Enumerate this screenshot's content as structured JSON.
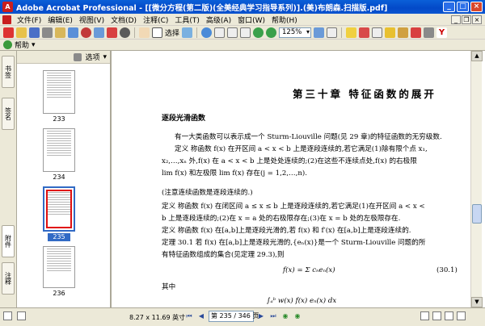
{
  "window": {
    "title": "Adobe Acrobat Professional - [[微分方程(第二版)(全美经典学习指导系列)].(美)布朗森.扫描版.pdf]",
    "app_icon": "acrobat-icon",
    "buttons": [
      "_",
      "□",
      "×"
    ]
  },
  "menubar": {
    "items": [
      "文件(F)",
      "编辑(E)",
      "视图(V)",
      "文档(D)",
      "注释(C)",
      "工具(T)",
      "高级(A)",
      "窗口(W)",
      "帮助(H)"
    ]
  },
  "toolbar": {
    "select_label": "选择",
    "zoom_value": "125%",
    "help_label": "帮助"
  },
  "thumbnails": {
    "options_label": "选项",
    "pages": [
      {
        "label": "233",
        "selected": false
      },
      {
        "label": "234",
        "selected": false
      },
      {
        "label": "235",
        "selected": true
      },
      {
        "label": "236",
        "selected": false
      }
    ]
  },
  "side_tabs": [
    "书签",
    "签名",
    "附件",
    "注释"
  ],
  "document": {
    "chapter_title": "第三十章   特征函数的展开",
    "section_title": "逐段光滑函数",
    "lines": [
      "有一大类函数可以表示成一个 Sturm-Liouville 问题(见 29 章)的特征函数的无穷级数.",
      "定义   称函数 f(x) 在开区间 a < x < b 上是逐段连续的,若它满足(1)除有限个点 x₁,",
      "x₂,…,xₙ 外,f(x) 在 a < x < b 上是处处连续的;(2)在这些不连续点处,f(x) 的右极限",
      "lim f(x) 和左极限 lim f(x) 存在(j = 1,2,…,n).",
      "(注意连续函数是逐段连续的.)",
      "定义   称函数 f(x) 在闭区间 a ≤ x ≤ b 上是逐段连续的,若它满足(1)在开区间 a < x <",
      "b 上是逐段连续的;(2)在 x = a 处的右极限存在;(3)在 x = b 处的左极限存在.",
      "定义   称函数 f(x) 在[a,b]上是逐段光滑的,若 f(x) 和 f′(x) 在[a,b]上是逐段连续的.",
      "定理 30.1   若 f(x) 在[a,b]上是逐段光滑的,{eₙ(x)}是一个 Sturm-Liouville 问题的所",
      "有特征函数组成的集合(见定理 29.3),则",
      "f(x) = Σ cₙeₙ(x)",
      "(30.1)",
      "其中",
      "∫ₐᵇ w(x) f(x) eₙ(x) dx"
    ]
  },
  "statusbar": {
    "page_size": "8.27 x 11.69 英寸",
    "page_indicator": "第 235 / 346 页"
  }
}
